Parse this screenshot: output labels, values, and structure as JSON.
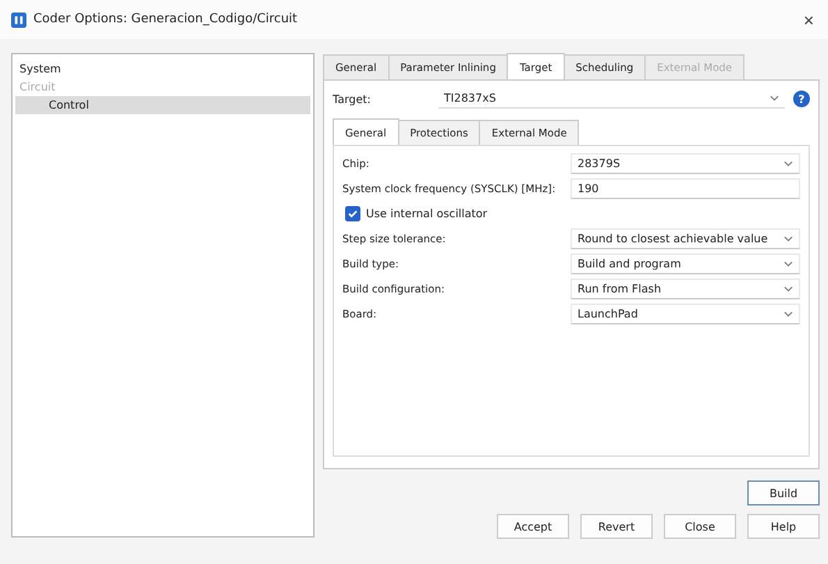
{
  "window": {
    "title": "Coder Options: Generacion_Codigo/Circuit",
    "close": "×"
  },
  "tree": [
    {
      "label": "System",
      "disabled": false,
      "selected": false
    },
    {
      "label": "Circuit",
      "disabled": true,
      "selected": false,
      "children": [
        {
          "label": "Control",
          "disabled": false,
          "selected": true
        }
      ]
    }
  ],
  "tabs": [
    {
      "label": "General",
      "selected": false,
      "disabled": false
    },
    {
      "label": "Parameter Inlining",
      "selected": false,
      "disabled": false
    },
    {
      "label": "Target",
      "selected": true,
      "disabled": false
    },
    {
      "label": "Scheduling",
      "selected": false,
      "disabled": false
    },
    {
      "label": "External Mode",
      "selected": false,
      "disabled": true
    }
  ],
  "target": {
    "label": "Target:",
    "value": "TI2837xS",
    "help": "?"
  },
  "inner_tabs": [
    {
      "label": "General",
      "selected": true
    },
    {
      "label": "Protections",
      "selected": false
    },
    {
      "label": "External Mode",
      "selected": false
    }
  ],
  "settings": [
    {
      "kind": "select",
      "label": "Chip:",
      "value": "28379S"
    },
    {
      "kind": "text",
      "label": "System clock frequency (SYSCLK) [MHz]:",
      "value": "190"
    },
    {
      "kind": "checkbox",
      "label": "Use internal oscillator",
      "checked": true
    },
    {
      "kind": "select",
      "label": "Step size tolerance:",
      "value": "Round to closest achievable value"
    },
    {
      "kind": "select",
      "label": "Build type:",
      "value": "Build and program"
    },
    {
      "kind": "select",
      "label": "Build configuration:",
      "value": "Run from Flash"
    },
    {
      "kind": "select",
      "label": "Board:",
      "value": "LaunchPad"
    }
  ],
  "build_button": "Build",
  "buttons": [
    "Accept",
    "Revert",
    "Close",
    "Help"
  ]
}
